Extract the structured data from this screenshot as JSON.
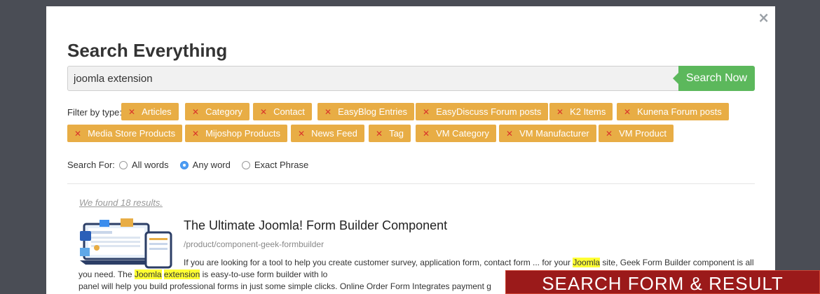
{
  "modal": {
    "close_glyph": "×",
    "title": "Search Everything",
    "search": {
      "value": "joomla extension",
      "button_label": "Search Now"
    },
    "filter": {
      "label": "Filter by type:",
      "tags": [
        "Articles",
        "Category",
        "Contact",
        "EasyBlog Entries",
        "EasyDiscuss Forum posts",
        "K2 Items",
        "Kunena Forum posts",
        "Media Store Products",
        "Mijoshop Products",
        "News Feed",
        "Tag",
        "VM Category",
        "VM Manufacturer",
        "VM Product"
      ]
    },
    "search_for": {
      "label": "Search For:",
      "options": [
        "All words",
        "Any word",
        "Exact Phrase"
      ],
      "selected": "Any word"
    },
    "results": {
      "found_text": "We found 18 results.",
      "items": [
        {
          "title": "The Ultimate Joomla! Form Builder Component",
          "url": "/product/component-geek-formbuilder",
          "desc_1": "If you are looking for a tool to help you create customer survey, application form, contact form ... for your ",
          "hl_1": "Joomla",
          "desc_2": " site, Geek Form Builder component is all you need. The ",
          "hl_2": "Joomla",
          "desc_3": " ",
          "hl_3": "extension",
          "desc_4": " is easy-to-use form builder with lo",
          "desc_5": "panel will help you build professional forms in just some simple clicks. Online Order Form Integrates payment g"
        }
      ]
    }
  },
  "banner": {
    "text": "SEARCH FORM & RESULT"
  },
  "colors": {
    "tag": "#e8ad45",
    "button": "#5cb85c",
    "banner": "#9b1a1a",
    "highlight": "#ffff33"
  }
}
